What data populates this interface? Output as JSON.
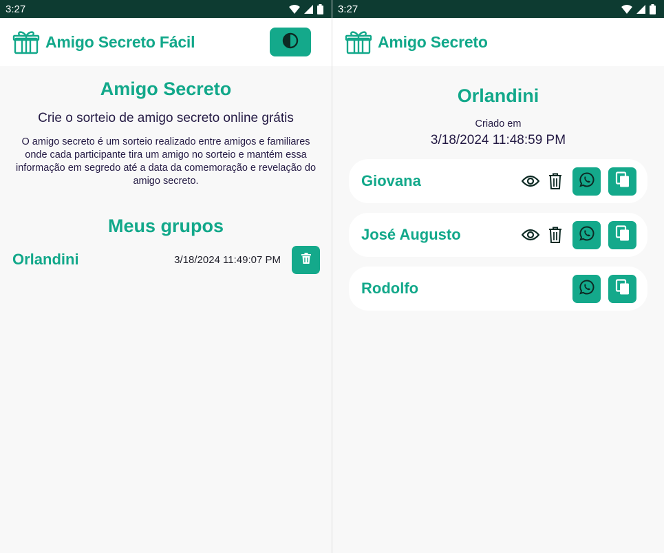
{
  "left": {
    "status": {
      "time": "3:27"
    },
    "appbar": {
      "title": "Amigo Secreto Fácil",
      "icon": "gift-icon",
      "theme_icon": "contrast-icon"
    },
    "hero": {
      "title": "Amigo Secreto",
      "subtitle": "Crie o sorteio de amigo secreto online grátis",
      "description": "O amigo secreto é um sorteio realizado entre amigos e familiares onde cada participante tira um amigo no sorteio e mantém essa informação em segredo até a data da comemoração e revelação do amigo secreto."
    },
    "groups": {
      "title": "Meus grupos",
      "items": [
        {
          "name": "Orlandini",
          "date": "3/18/2024 11:49:07 PM"
        }
      ]
    }
  },
  "right": {
    "status": {
      "time": "3:27"
    },
    "appbar": {
      "title": "Amigo Secreto",
      "icon": "gift-icon"
    },
    "group": {
      "title": "Orlandini",
      "created_label": "Criado em",
      "created_date": "3/18/2024 11:48:59 PM"
    },
    "participants": [
      {
        "name": "Giovana"
      },
      {
        "name": "José Augusto"
      },
      {
        "name": "Rodolfo"
      }
    ]
  },
  "colors": {
    "accent": "#14a98b",
    "status_bar": "#0d3b31",
    "text_dark": "#241a44",
    "background": "#f8f8f8"
  }
}
